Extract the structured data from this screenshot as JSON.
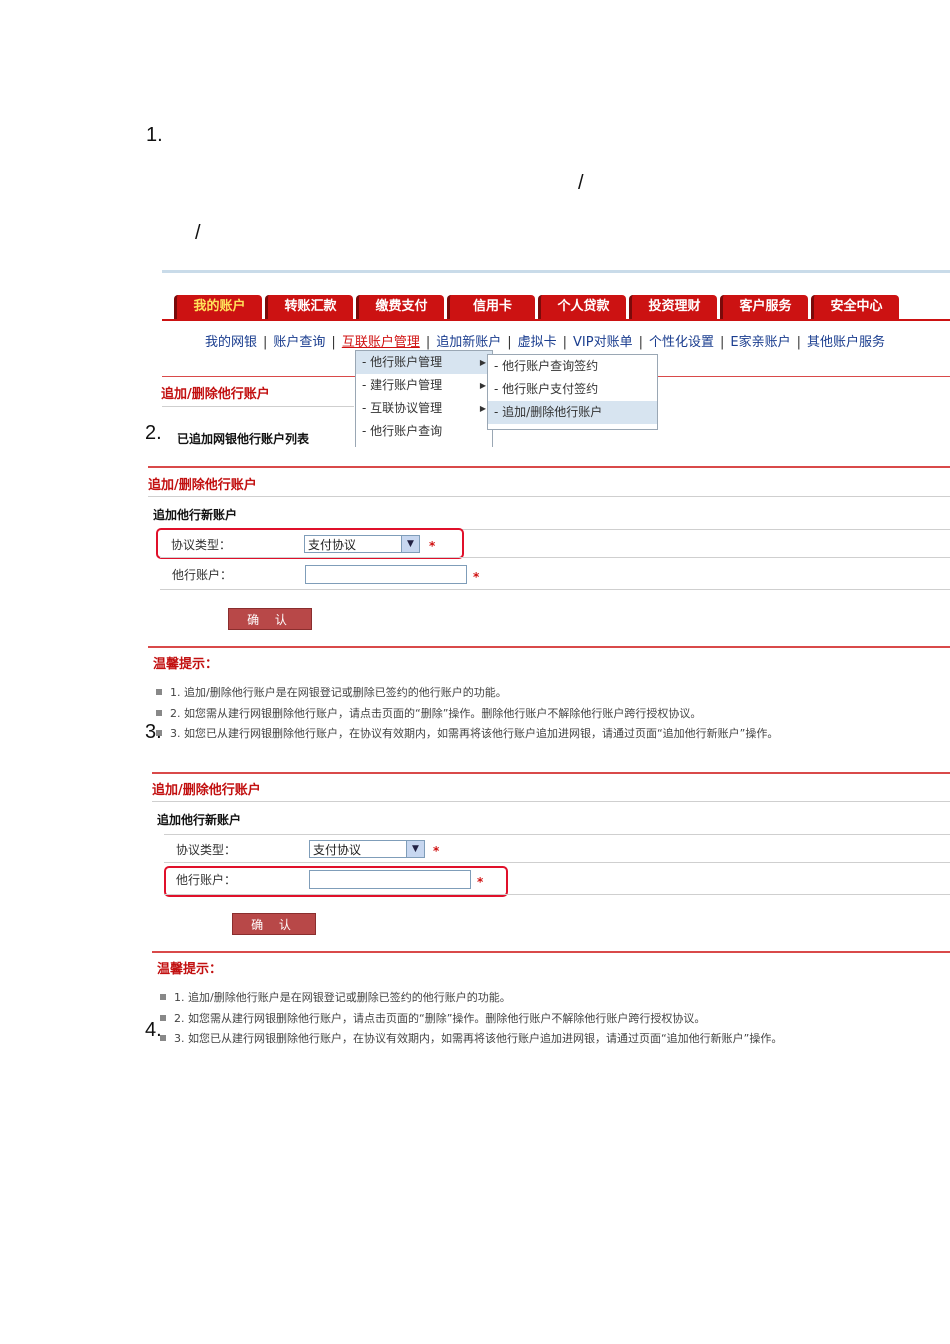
{
  "steps": [
    "1.",
    "2.",
    "3.",
    "4."
  ],
  "slash": "/",
  "tabs": [
    "我的账户",
    "转账汇款",
    "缴费支付",
    "信用卡",
    "个人贷款",
    "投资理财",
    "客户服务",
    "安全中心"
  ],
  "subnav": [
    "我的网银",
    "账户查询",
    "互联账户管理",
    "追加新账户",
    "虚拟卡",
    "VIP对账单",
    "个性化设置",
    "E家亲账户",
    "其他账户服务"
  ],
  "subnav_sep": "|",
  "menu1": [
    "- 他行账户管理",
    "- 建行账户管理",
    "- 互联协议管理",
    "- 他行账户查询"
  ],
  "menu2": [
    "- 他行账户查询签约",
    "- 他行账户支付签约",
    "- 追加/删除他行账户"
  ],
  "menu_arrow": "▶",
  "screen1": {
    "title": "追加/删除他行账户",
    "list_title": "已追加网银他行账户列表"
  },
  "form": {
    "title": "追加/删除他行账户",
    "subtitle": "追加他行新账户",
    "type_label": "协议类型：",
    "type_value": "支付协议",
    "account_label": "他行账户：",
    "required": "*",
    "confirm": "确 认",
    "tips_title": "温馨提示：",
    "tips": [
      "1. 追加/删除他行账户是在网银登记或删除已签约的他行账户的功能。",
      "2. 如您需从建行网银删除他行账户，请点击页面的“删除”操作。删除他行账户不解除他行账户跨行授权协议。",
      "3. 如您已从建行网银删除他行账户，在协议有效期内，如需再将该他行账户追加进网银，请通过页面“追加他行新账户”操作。"
    ]
  }
}
